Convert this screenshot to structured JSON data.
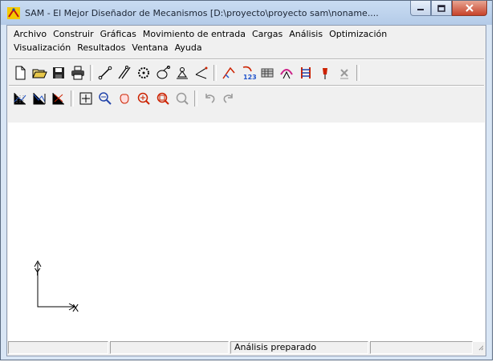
{
  "window": {
    "title": "SAM - El Mejor Diseñador de Mecanismos [D:\\proyecto\\proyecto sam\\noname....",
    "minimize_icon": "minimize-icon",
    "maximize_icon": "maximize-icon",
    "close_icon": "close-icon"
  },
  "menu": {
    "row1": [
      "Archivo",
      "Construir",
      "Gráficas",
      "Movimiento de entrada",
      "Cargas",
      "Análisis",
      "Optimización"
    ],
    "row2": [
      "Visualización",
      "Resultados",
      "Ventana",
      "Ayuda"
    ]
  },
  "toolbar1": [
    "new-file-icon",
    "open-folder-icon",
    "save-icon",
    "print-icon",
    "link-icon",
    "slider-link-icon",
    "gear-icon",
    "cam-icon",
    "ground-support-icon",
    "angle-icon",
    "input-motion-icon",
    "numbering-icon",
    "table-icon",
    "analysis-arc-icon",
    "ladder-icon",
    "pin-icon",
    "lamp-icon"
  ],
  "toolbar2": [
    "grid-snap-icon",
    "grid-icon",
    "grid-clear-icon",
    "cursor-icon",
    "zoom-out-icon",
    "pan-icon",
    "zoom-window-icon",
    "zoom-extent-icon",
    "zoom-previous-icon",
    "undo-icon",
    "redo-icon"
  ],
  "canvas": {
    "x_axis_label": "X",
    "y_axis_label": "Y"
  },
  "statusbar": {
    "cells": [
      "",
      "",
      "Análisis preparado",
      "",
      ""
    ]
  },
  "colors": {
    "frame": "#d9e6f5",
    "close_button": "#c7422a",
    "toolbar_accent": "#cc2200"
  }
}
